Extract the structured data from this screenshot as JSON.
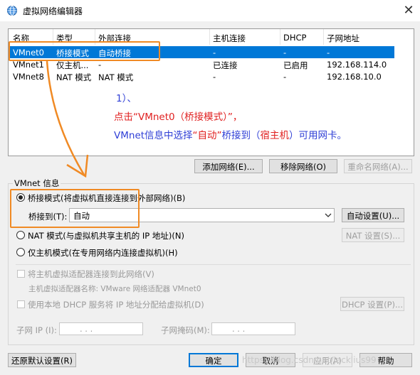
{
  "window": {
    "title": "虚拟网络编辑器",
    "icon": "globe-icon",
    "close_glyph": "✕"
  },
  "table": {
    "columns": [
      "名称",
      "类型",
      "外部连接",
      "主机连接",
      "DHCP",
      "子网地址"
    ],
    "rows": [
      {
        "name": "VMnet0",
        "type": "桥接模式",
        "external": "自动桥接",
        "host": "-",
        "dhcp": "-",
        "subnet": "-",
        "selected": true
      },
      {
        "name": "VMnet1",
        "type": "仅主机...",
        "external": "-",
        "host": "已连接",
        "dhcp": "已启用",
        "subnet": "192.168.114.0",
        "selected": false
      },
      {
        "name": "VMnet8",
        "type": "NAT 模式",
        "external": "NAT 模式",
        "host": "-",
        "dhcp": "-",
        "subnet": "192.168.10.0",
        "selected": false
      }
    ]
  },
  "annotation": {
    "line1": "1）、",
    "line2_prefix": "点击",
    "line2_highlight": "“VMnet0（桥接模式）”",
    "line2_suffix": "，",
    "line3_prefix": "VMnet信息中选择",
    "line3_auto": "“自动”",
    "line3_mid": "桥接到（",
    "line3_host": "宿主机",
    "line3_suffix": "）可用网卡。",
    "colors": {
      "red": "#e02020",
      "blue": "#2f3fd6",
      "orange": "#f08a24"
    }
  },
  "table_buttons": {
    "add_network": "添加网络(E)...",
    "remove_network": "移除网络(O)",
    "rename_network": "重命名网络(A)..."
  },
  "vmnet_info": {
    "group_title": "VMnet 信息",
    "bridged_label": "桥接模式(将虚拟机直接连接到外部网络)(B)",
    "bridged_to_label": "桥接到(T):",
    "bridged_to_value": "自动",
    "auto_settings": "自动设置(U)...",
    "nat_label": "NAT 模式(与虚拟机共享主机的 IP 地址)(N)",
    "nat_settings": "NAT 设置(S)...",
    "host_only_label": "仅主机模式(在专用网络内连接虚拟机)(H)",
    "connect_adapter_label": "将主机虚拟适配器连接到此网络(V)",
    "adapter_name_label": "主机虚拟适配器名称: VMware 网络适配器 VMnet0",
    "dhcp_label": "使用本地 DHCP 服务将 IP 地址分配给虚拟机(D)",
    "dhcp_settings": "DHCP 设置(P)...",
    "subnet_ip_label": "子网 IP (I):",
    "subnet_mask_label": "子网掩码(M):",
    "ip_dots": ".     .     ."
  },
  "footer": {
    "restore_defaults": "还原默认设置(R)",
    "ok": "确定",
    "cancel": "取消",
    "apply": "应用(A)",
    "help": "帮助"
  },
  "watermark": "https://blog.csdn.net/Jacklius99"
}
